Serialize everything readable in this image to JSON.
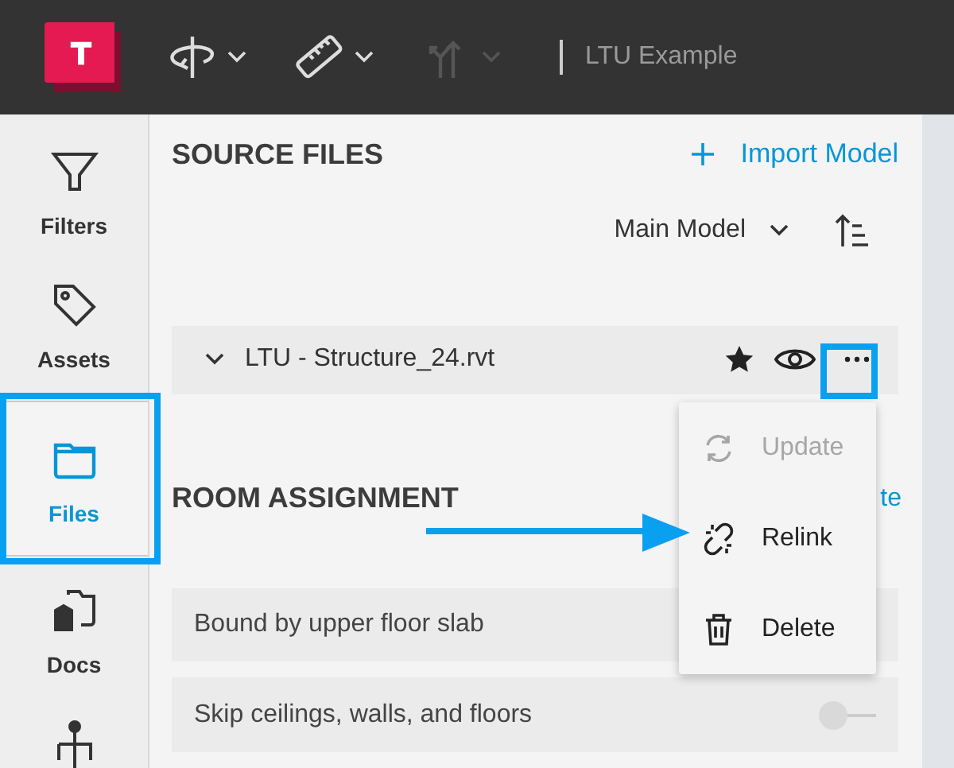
{
  "toolbar": {
    "project": "LTU Example",
    "tools": [
      {
        "kind": "orbit",
        "disabled": false
      },
      {
        "kind": "ruler",
        "disabled": false
      },
      {
        "kind": "branch",
        "disabled": true
      }
    ]
  },
  "sidebar": {
    "items": [
      {
        "kind": "filter",
        "label": "Filters",
        "selected": false
      },
      {
        "kind": "tag",
        "label": "Assets",
        "selected": false
      },
      {
        "kind": "folder",
        "label": "Files",
        "selected": true
      },
      {
        "kind": "docs",
        "label": "Docs",
        "selected": false
      },
      {
        "kind": "tree",
        "selected": false
      }
    ]
  },
  "source_files": {
    "title": "SOURCE FILES",
    "import_label": "Import Model",
    "model_select": "Main Model",
    "file": {
      "name": "LTU - Structure_24.rvt",
      "starred": true
    }
  },
  "menu": {
    "items": [
      {
        "kind": "update",
        "label": "Update",
        "disabled": true
      },
      {
        "kind": "relink",
        "label": "Relink",
        "disabled": false
      },
      {
        "kind": "delete",
        "label": "Delete",
        "disabled": false
      }
    ]
  },
  "room_assignment": {
    "title": "ROOM ASSIGNMENT",
    "link": "te",
    "options": [
      {
        "label": "Bound by upper floor slab"
      },
      {
        "label": "Skip ceilings, walls, and floors",
        "on": false
      }
    ]
  }
}
